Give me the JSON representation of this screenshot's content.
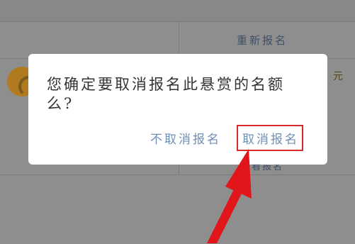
{
  "background": {
    "reenroll_label": "重新报名",
    "currency_suffix": "元",
    "obscured_text": "查看报名"
  },
  "dialog": {
    "message": "您确定要取消报名此悬赏的名额么?",
    "keep_button": "不取消报名",
    "confirm_button": "取消报名"
  },
  "colors": {
    "overlay": "#8e8e8e",
    "dialog_bg": "#ffffff",
    "button_text": "#6f8fb4",
    "highlight_red": "#d4282a",
    "arrow_red": "#e0161b"
  }
}
